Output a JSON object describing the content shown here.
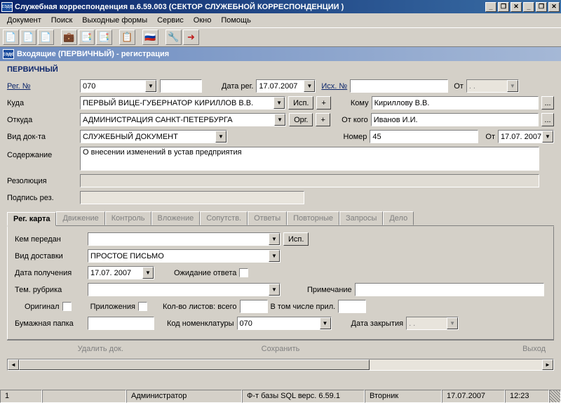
{
  "window": {
    "title": "Служебная корреспонденция в.6.59.003 (СЕКТОР СЛУЖЕБНОЙ КОРРЕСПОНДЕНЦИИ )",
    "icon_text": "сэдо"
  },
  "menu": [
    "Документ",
    "Поиск",
    "Выходные формы",
    "Сервис",
    "Окно",
    "Помощь"
  ],
  "subtitle": "Входящие (ПЕРВИЧНЫЙ) - регистрация",
  "section": "ПЕРВИЧНЫЙ",
  "labels": {
    "reg_no": "Рег. №",
    "date_reg": "Дата рег.",
    "isx_no": "Исх. №",
    "ot": "От",
    "kuda": "Куда",
    "isp": "Исп.",
    "plus": "+",
    "komu": "Кому",
    "otkuda": "Откуда",
    "org": "Орг.",
    "ot_kogo": "От кого",
    "vid_dok": "Вид док-та",
    "nomer": "Номер",
    "soderzh": "Содержание",
    "rezol": "Резолюция",
    "podpis": "Подпись рез.",
    "kem_peredan": "Кем передан",
    "vid_dostavki": "Вид доставки",
    "data_polucheniya": "Дата получения",
    "ozhidanie": "Ожидание ответа",
    "tem_rubrika": "Тем. рубрика",
    "primechanie": "Примечание",
    "original": "Оригинал",
    "prilozheniya": "Приложения",
    "kolvo_listov": "Кол-во листов: всего",
    "v_tom_chisle": "В том числе прил.",
    "bumazh_papka": "Бумажная папка",
    "kod_nomen": "Код номенклатуры",
    "data_zakr": "Дата закрытия"
  },
  "values": {
    "reg_no": "070",
    "date_reg": "17.07.2007",
    "isx_no": "",
    "ot1": "  .  .",
    "kuda": "ПЕРВЫЙ ВИЦЕ-ГУБЕРНАТОР КИРИЛЛОВ В.В.",
    "komu": "Кириллову В.В.",
    "otkuda": "АДМИНИСТРАЦИЯ САНКТ-ПЕТЕРБУРГА",
    "ot_kogo": "Иванов И.И.",
    "vid_dok": "СЛУЖЕБНЫЙ ДОКУМЕНТ",
    "nomer": "45",
    "ot2": "17.07. 2007",
    "soderzh": "О внесении изменений в устав предприятия",
    "rezol": "",
    "podpis": "",
    "kem_peredan": "",
    "vid_dostavki": "ПРОСТОЕ ПИСЬМО",
    "data_polucheniya": "17.07. 2007",
    "tem_rubrika": "",
    "primechanie": "",
    "bumazh_papka": "",
    "kod_nomen": "070",
    "data_zakr": "  .  ."
  },
  "tabs": [
    "Рег. карта",
    "Движение",
    "Контроль",
    "Вложение",
    "Сопутств.",
    "Ответы",
    "Повторные",
    "Запросы",
    "Дело"
  ],
  "footer_buttons": [
    "Удалить док.",
    "Сохранить",
    "Выход"
  ],
  "statusbar": {
    "num": "1",
    "user": "Администратор",
    "db": "Ф-т базы SQL верс. 6.59.1",
    "day": "Вторник",
    "date": "17.07.2007",
    "time": "12:23"
  }
}
